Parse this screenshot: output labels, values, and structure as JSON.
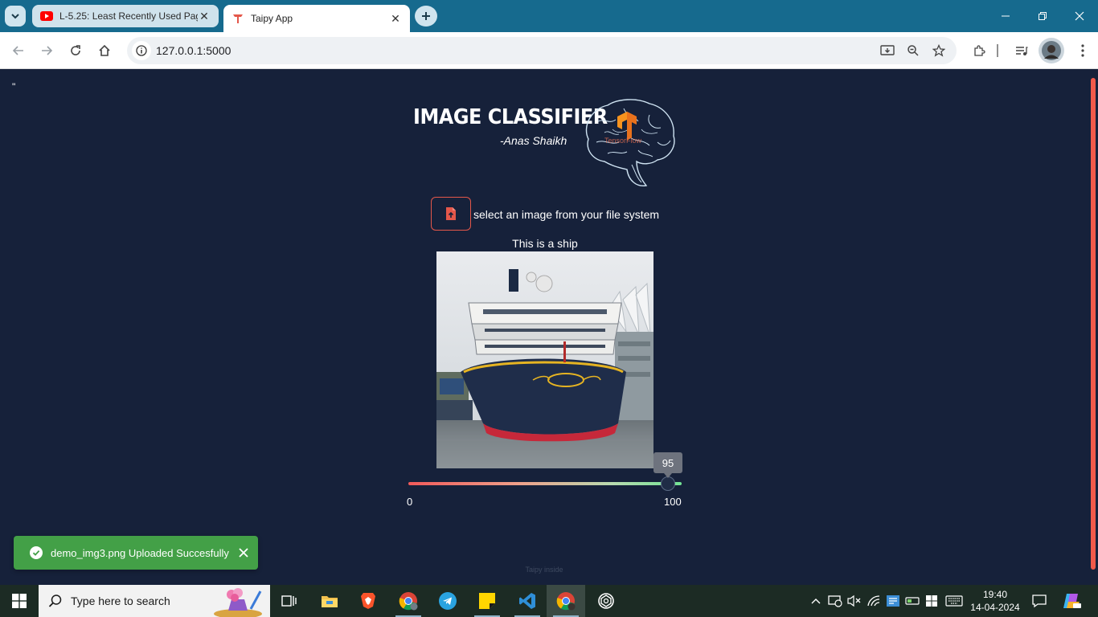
{
  "browser": {
    "tabs": [
      {
        "title": "L-5.25: Least Recently Used Pag",
        "favicon": "youtube-icon"
      },
      {
        "title": "Taipy App",
        "favicon": "taipy-icon"
      }
    ],
    "url": "127.0.0.1:5000"
  },
  "page": {
    "stray_text": "\"",
    "header": {
      "title": "IMAGE CLASSIFIER",
      "author": "-Anas Shaikh",
      "logo_text": "TensorFlow"
    },
    "upload": {
      "label": "select an image from your file system"
    },
    "result": {
      "text": "This is a ship"
    },
    "slider": {
      "value": 95,
      "min_label": "0",
      "max_label": "100",
      "min": 0,
      "max": 100
    },
    "toast": {
      "message": "demo_img3.png Uploaded Succesfully"
    },
    "footer": "Taipy inside"
  },
  "taskbar": {
    "search_placeholder": "Type here to search",
    "time": "19:40",
    "date": "14-04-2024"
  },
  "colors": {
    "accent": "#e4574a",
    "page_bg": "#16213a",
    "success": "#43a047",
    "chrome_tabbar": "#166a8e"
  }
}
